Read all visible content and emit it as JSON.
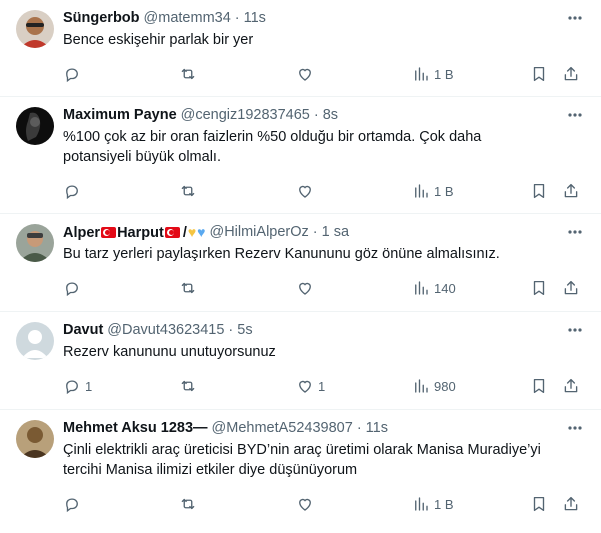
{
  "tweets": [
    {
      "name": "Süngerbob",
      "handle": "@matemm34",
      "time": "11s",
      "text": "Bence eskişehir parlak bir yer",
      "replies": "",
      "retweets": "",
      "likes": "",
      "views": "1 B",
      "avatar_color": "#a9734b"
    },
    {
      "name": "Maximum Payne",
      "handle": "@cengiz192837465",
      "time": "8s",
      "text": "%100 çok az bir oran faizlerin %50 olduğu bir ortamda. Çok daha potansiyeli büyük olmalı.",
      "replies": "",
      "retweets": "",
      "likes": "",
      "views": "1 B",
      "avatar_color": "#1a1a1a"
    },
    {
      "name": "Alper",
      "name_part2": "Harput",
      "name_part3": "/",
      "handle": "@HilmiAlperOz",
      "time": "1 sa",
      "text": "Bu tarz yerleri paylaşırken Rezerv Kanununu göz önüne almalısınız.",
      "replies": "",
      "retweets": "",
      "likes": "",
      "views": "140",
      "avatar_color": "#5a6b55"
    },
    {
      "name": "Davut",
      "handle": "@Davut43623415",
      "time": "5s",
      "text": "Rezerv kanununu unutuyorsunuz",
      "replies": "1",
      "retweets": "",
      "likes": "1",
      "views": "980",
      "avatar_color": "#cfd9de"
    },
    {
      "name": "Mehmet Aksu 1283—",
      "handle": "@MehmetA52439807",
      "time": "11s",
      "text": "Çinli elektrikli araç üreticisi BYD’nin araç üretimi  olarak Manisa Muradiye’yi tercihi Manisa ilimizi  etkiler diye düşünüyorum",
      "replies": "",
      "retweets": "",
      "likes": "",
      "views": "1 B",
      "avatar_color": "#8b6a3e"
    }
  ],
  "separator": "·",
  "icons": {
    "reply": "reply-icon",
    "retweet": "retweet-icon",
    "like": "heart-icon",
    "views": "views-icon",
    "bookmark": "bookmark-icon",
    "share": "share-icon",
    "more": "more-icon"
  }
}
